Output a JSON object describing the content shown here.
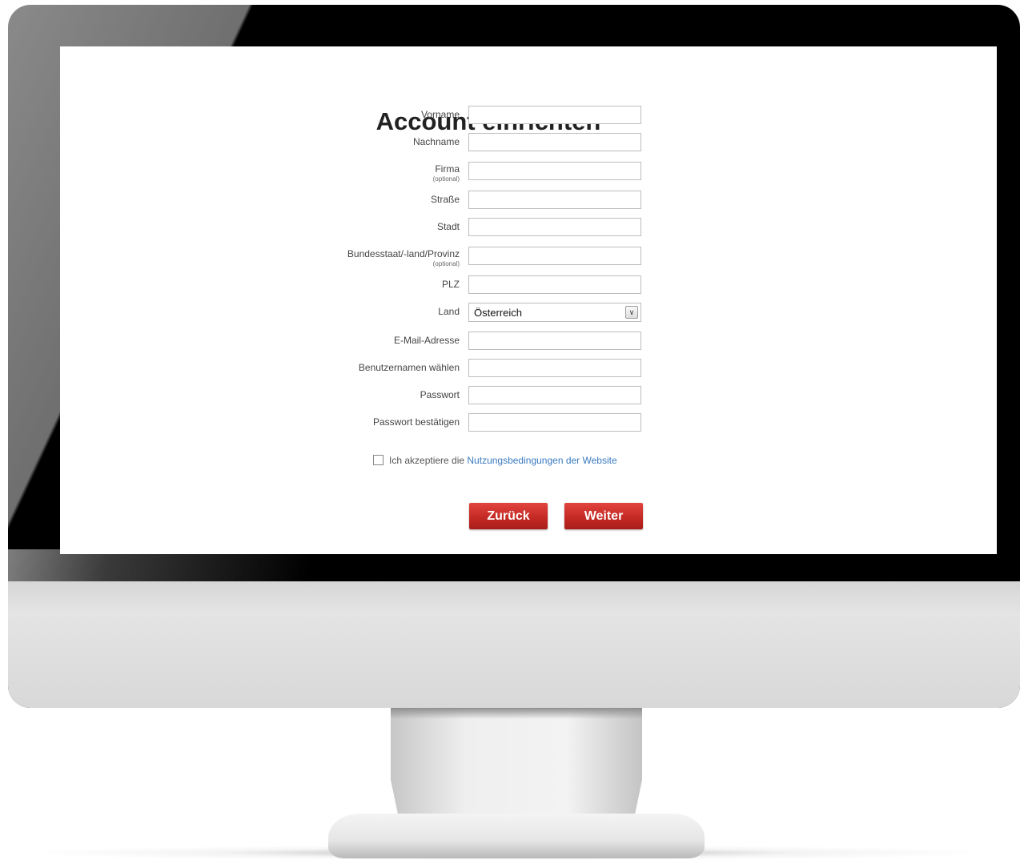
{
  "form": {
    "title": "Account einrichten",
    "fields": [
      {
        "label": "Vorname",
        "sub": "",
        "value": ""
      },
      {
        "label": "Nachname",
        "sub": "",
        "value": ""
      },
      {
        "label": "Firma",
        "sub": "(optional)",
        "value": ""
      },
      {
        "label": "Straße",
        "sub": "",
        "value": ""
      },
      {
        "label": "Stadt",
        "sub": "",
        "value": ""
      },
      {
        "label": "Bundesstaat/-land/Provinz",
        "sub": "(optional)",
        "value": ""
      },
      {
        "label": "PLZ",
        "sub": "",
        "value": ""
      },
      {
        "label": "Land",
        "sub": "",
        "value": "Österreich",
        "type": "select"
      },
      {
        "label": "E-Mail-Adresse",
        "sub": "",
        "value": ""
      },
      {
        "label": "Benutzernamen wählen",
        "sub": "",
        "value": ""
      },
      {
        "label": "Passwort",
        "sub": "",
        "value": ""
      },
      {
        "label": "Passwort bestätigen",
        "sub": "",
        "value": ""
      }
    ],
    "terms": {
      "prefix": "Ich akzeptiere die ",
      "link": "Nutzungsbedingungen der Website",
      "checked": false
    },
    "buttons": {
      "back": "Zurück",
      "next": "Weiter"
    }
  },
  "colors": {
    "button": "#c52a25",
    "link": "#3a7bbf"
  },
  "icons": {
    "select_arrow": "chevron-down-icon"
  }
}
